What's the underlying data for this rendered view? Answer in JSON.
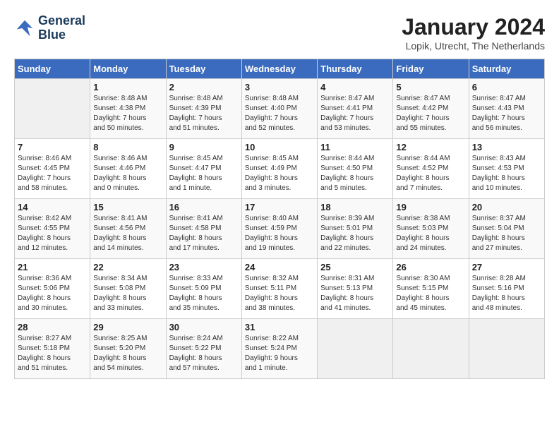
{
  "header": {
    "logo_line1": "General",
    "logo_line2": "Blue",
    "title": "January 2024",
    "subtitle": "Lopik, Utrecht, The Netherlands"
  },
  "weekdays": [
    "Sunday",
    "Monday",
    "Tuesday",
    "Wednesday",
    "Thursday",
    "Friday",
    "Saturday"
  ],
  "weeks": [
    [
      {
        "day": "",
        "info": ""
      },
      {
        "day": "1",
        "info": "Sunrise: 8:48 AM\nSunset: 4:38 PM\nDaylight: 7 hours\nand 50 minutes."
      },
      {
        "day": "2",
        "info": "Sunrise: 8:48 AM\nSunset: 4:39 PM\nDaylight: 7 hours\nand 51 minutes."
      },
      {
        "day": "3",
        "info": "Sunrise: 8:48 AM\nSunset: 4:40 PM\nDaylight: 7 hours\nand 52 minutes."
      },
      {
        "day": "4",
        "info": "Sunrise: 8:47 AM\nSunset: 4:41 PM\nDaylight: 7 hours\nand 53 minutes."
      },
      {
        "day": "5",
        "info": "Sunrise: 8:47 AM\nSunset: 4:42 PM\nDaylight: 7 hours\nand 55 minutes."
      },
      {
        "day": "6",
        "info": "Sunrise: 8:47 AM\nSunset: 4:43 PM\nDaylight: 7 hours\nand 56 minutes."
      }
    ],
    [
      {
        "day": "7",
        "info": "Sunrise: 8:46 AM\nSunset: 4:45 PM\nDaylight: 7 hours\nand 58 minutes."
      },
      {
        "day": "8",
        "info": "Sunrise: 8:46 AM\nSunset: 4:46 PM\nDaylight: 8 hours\nand 0 minutes."
      },
      {
        "day": "9",
        "info": "Sunrise: 8:45 AM\nSunset: 4:47 PM\nDaylight: 8 hours\nand 1 minute."
      },
      {
        "day": "10",
        "info": "Sunrise: 8:45 AM\nSunset: 4:49 PM\nDaylight: 8 hours\nand 3 minutes."
      },
      {
        "day": "11",
        "info": "Sunrise: 8:44 AM\nSunset: 4:50 PM\nDaylight: 8 hours\nand 5 minutes."
      },
      {
        "day": "12",
        "info": "Sunrise: 8:44 AM\nSunset: 4:52 PM\nDaylight: 8 hours\nand 7 minutes."
      },
      {
        "day": "13",
        "info": "Sunrise: 8:43 AM\nSunset: 4:53 PM\nDaylight: 8 hours\nand 10 minutes."
      }
    ],
    [
      {
        "day": "14",
        "info": "Sunrise: 8:42 AM\nSunset: 4:55 PM\nDaylight: 8 hours\nand 12 minutes."
      },
      {
        "day": "15",
        "info": "Sunrise: 8:41 AM\nSunset: 4:56 PM\nDaylight: 8 hours\nand 14 minutes."
      },
      {
        "day": "16",
        "info": "Sunrise: 8:41 AM\nSunset: 4:58 PM\nDaylight: 8 hours\nand 17 minutes."
      },
      {
        "day": "17",
        "info": "Sunrise: 8:40 AM\nSunset: 4:59 PM\nDaylight: 8 hours\nand 19 minutes."
      },
      {
        "day": "18",
        "info": "Sunrise: 8:39 AM\nSunset: 5:01 PM\nDaylight: 8 hours\nand 22 minutes."
      },
      {
        "day": "19",
        "info": "Sunrise: 8:38 AM\nSunset: 5:03 PM\nDaylight: 8 hours\nand 24 minutes."
      },
      {
        "day": "20",
        "info": "Sunrise: 8:37 AM\nSunset: 5:04 PM\nDaylight: 8 hours\nand 27 minutes."
      }
    ],
    [
      {
        "day": "21",
        "info": "Sunrise: 8:36 AM\nSunset: 5:06 PM\nDaylight: 8 hours\nand 30 minutes."
      },
      {
        "day": "22",
        "info": "Sunrise: 8:34 AM\nSunset: 5:08 PM\nDaylight: 8 hours\nand 33 minutes."
      },
      {
        "day": "23",
        "info": "Sunrise: 8:33 AM\nSunset: 5:09 PM\nDaylight: 8 hours\nand 35 minutes."
      },
      {
        "day": "24",
        "info": "Sunrise: 8:32 AM\nSunset: 5:11 PM\nDaylight: 8 hours\nand 38 minutes."
      },
      {
        "day": "25",
        "info": "Sunrise: 8:31 AM\nSunset: 5:13 PM\nDaylight: 8 hours\nand 41 minutes."
      },
      {
        "day": "26",
        "info": "Sunrise: 8:30 AM\nSunset: 5:15 PM\nDaylight: 8 hours\nand 45 minutes."
      },
      {
        "day": "27",
        "info": "Sunrise: 8:28 AM\nSunset: 5:16 PM\nDaylight: 8 hours\nand 48 minutes."
      }
    ],
    [
      {
        "day": "28",
        "info": "Sunrise: 8:27 AM\nSunset: 5:18 PM\nDaylight: 8 hours\nand 51 minutes."
      },
      {
        "day": "29",
        "info": "Sunrise: 8:25 AM\nSunset: 5:20 PM\nDaylight: 8 hours\nand 54 minutes."
      },
      {
        "day": "30",
        "info": "Sunrise: 8:24 AM\nSunset: 5:22 PM\nDaylight: 8 hours\nand 57 minutes."
      },
      {
        "day": "31",
        "info": "Sunrise: 8:22 AM\nSunset: 5:24 PM\nDaylight: 9 hours\nand 1 minute."
      },
      {
        "day": "",
        "info": ""
      },
      {
        "day": "",
        "info": ""
      },
      {
        "day": "",
        "info": ""
      }
    ]
  ]
}
